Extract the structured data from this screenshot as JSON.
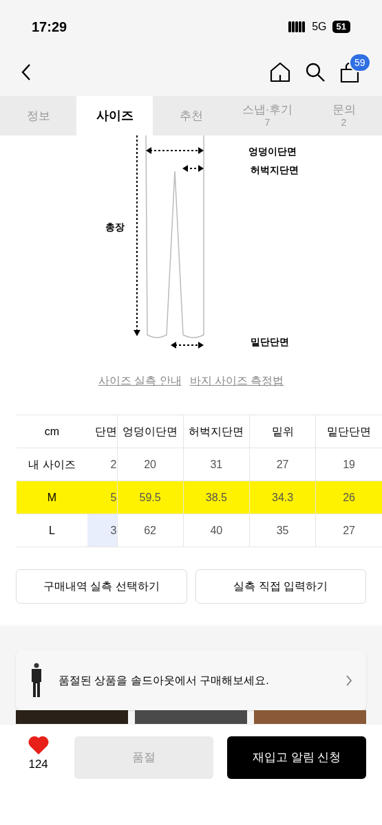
{
  "status_bar": {
    "time": "17:29",
    "network": "5G",
    "battery": "51"
  },
  "nav": {
    "cart_count": "59"
  },
  "tabs": [
    {
      "label": "정보",
      "selected": false
    },
    {
      "label": "사이즈",
      "selected": true
    },
    {
      "label": "추천",
      "selected": false
    },
    {
      "label": "스냅·후기",
      "count": "7",
      "selected": false
    },
    {
      "label": "문의",
      "count": "2",
      "selected": false
    }
  ],
  "diagram": {
    "labels": [
      "엉덩이단면",
      "허벅지단면",
      "총장",
      "밑단단면"
    ]
  },
  "links": [
    "사이즈 실측 안내",
    "바지 사이즈 측정법"
  ],
  "size_table": {
    "columns": [
      "cm",
      "단면",
      "엉덩이단면",
      "허벅지단면",
      "밑위",
      "밑단단면"
    ],
    "rows": [
      {
        "cells": [
          "내 사이즈",
          "2",
          "20",
          "31",
          "27",
          "19"
        ],
        "highlighted": false
      },
      {
        "cells": [
          "M",
          "5",
          "59.5",
          "38.5",
          "34.3",
          "26"
        ],
        "highlighted": true
      },
      {
        "cells": [
          "L",
          "3",
          "62",
          "40",
          "35",
          "27"
        ],
        "highlighted": false
      }
    ]
  },
  "actions": [
    "구매내역 실측 선택하기",
    "실측 직접 입력하기"
  ],
  "toast": {
    "text": "품절된 상품을 솔드아웃에서 구매해보세요."
  },
  "bottom_bar": {
    "liked": true,
    "likes": "124",
    "sold_out": {
      "label": "품절",
      "disabled": true
    },
    "restock": "재입고 알림 신청"
  }
}
